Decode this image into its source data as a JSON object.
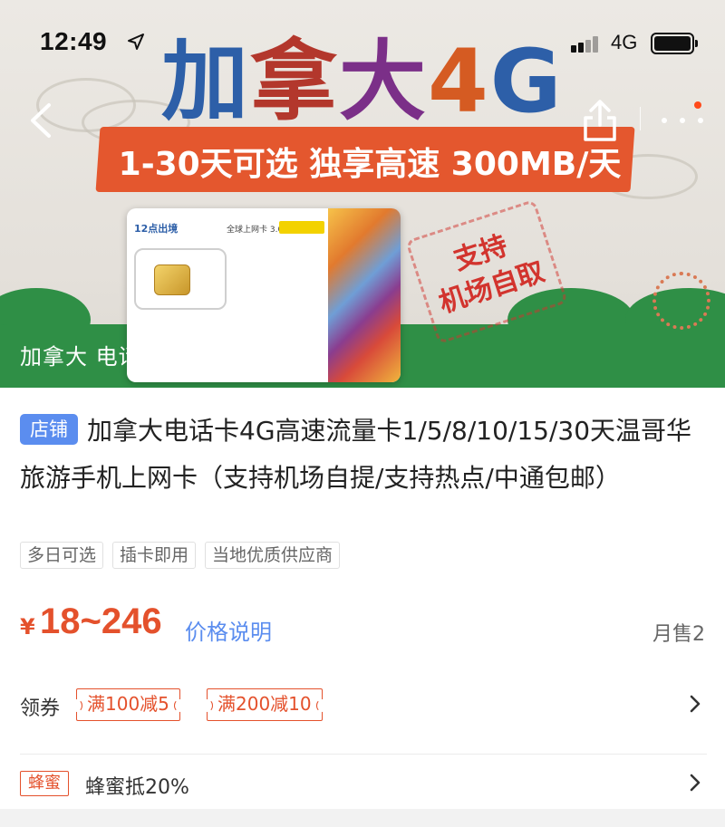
{
  "status_bar": {
    "time": "12:49",
    "network": "4G",
    "icons": [
      "location-arrow-icon",
      "signal-icon",
      "battery-icon"
    ]
  },
  "hero": {
    "title_chars": [
      "加",
      "拿",
      "大",
      "4",
      "G"
    ],
    "banner_text": "1-30天可选 独享高速 300MB/天",
    "stamp_line1": "支持",
    "stamp_line2": "机场自取",
    "sim_logo": "12点出境",
    "sim_subtitle": "全球上网卡 3.0",
    "caption": "加拿大 电话",
    "nav_icons": [
      "back-icon",
      "share-icon",
      "more-icon"
    ],
    "colors": {
      "banner": "#e4572e",
      "ground": "#2f8f46"
    }
  },
  "product": {
    "shop_badge": "店铺",
    "title": "加拿大电话卡4G高速流量卡1/5/8/10/15/30天温哥华旅游手机上网卡（支持机场自提/支持热点/中通包邮）",
    "tags": [
      "多日可选",
      "插卡即用",
      "当地优质供应商"
    ],
    "price_symbol": "¥",
    "price_range": "18~246",
    "price_explain": "价格说明",
    "monthly_sales": "月售2",
    "colors": {
      "price": "#e4512c",
      "link": "#5b8def"
    }
  },
  "coupons": {
    "label": "领券",
    "items": [
      "满100减5",
      "满200减10"
    ]
  },
  "honey": {
    "badge": "蜂蜜",
    "text": "蜂蜜抵20%"
  }
}
